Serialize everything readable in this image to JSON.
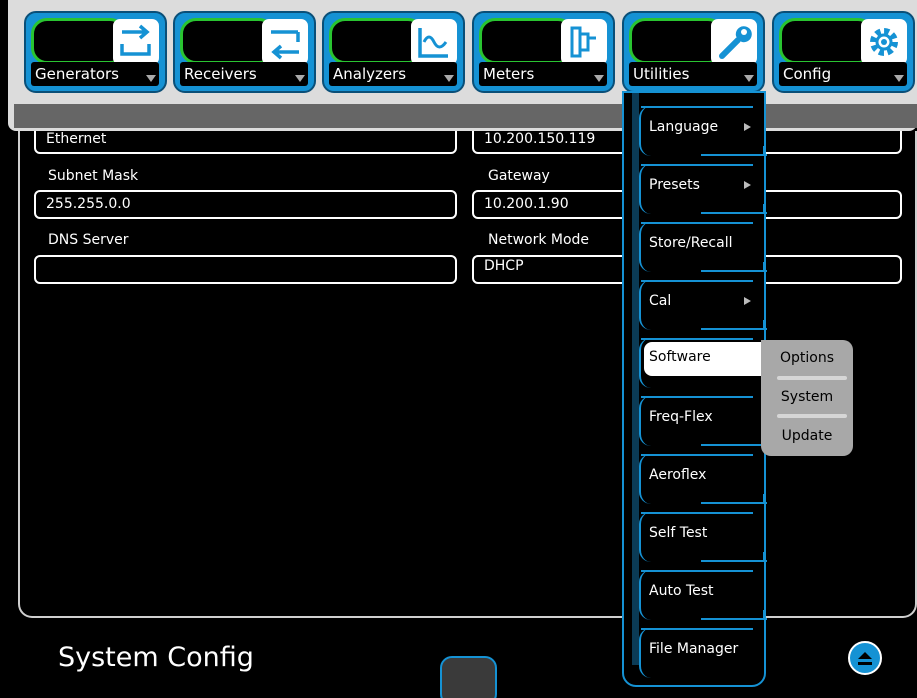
{
  "tabs": [
    {
      "label": "Generators",
      "icon": "generators-arrows-icon"
    },
    {
      "label": "Receivers",
      "icon": "receivers-arrows-icon"
    },
    {
      "label": "Analyzers",
      "icon": "analyzer-wave-icon"
    },
    {
      "label": "Meters",
      "icon": "meter-probe-icon"
    },
    {
      "label": "Utilities",
      "icon": "wrench-icon"
    },
    {
      "label": "Config",
      "icon": "gear-icon"
    }
  ],
  "config": {
    "ethernet_label": "Ethernet",
    "ip_value": "10.200.150.119",
    "subnet_label": "Subnet Mask",
    "subnet_value": "255.255.0.0",
    "gateway_label": "Gateway",
    "gateway_value": "10.200.1.90",
    "dns_label": "DNS Server",
    "dns_value": "",
    "network_mode_label": "Network Mode",
    "network_mode_value": "DHCP"
  },
  "utilities_menu": {
    "items": [
      {
        "label": "Language",
        "has_submenu": true
      },
      {
        "label": "Presets",
        "has_submenu": true
      },
      {
        "label": "Store/Recall",
        "has_submenu": false
      },
      {
        "label": "Cal",
        "has_submenu": true
      },
      {
        "label": "Software",
        "has_submenu": true,
        "selected": true
      },
      {
        "label": "Freq-Flex",
        "has_submenu": false
      },
      {
        "label": "Aeroflex",
        "has_submenu": false
      },
      {
        "label": "Self Test",
        "has_submenu": false
      },
      {
        "label": "Auto Test",
        "has_submenu": false
      },
      {
        "label": "File Manager",
        "has_submenu": false
      }
    ]
  },
  "software_submenu": {
    "items": [
      "Options",
      "System",
      "Update"
    ]
  },
  "footer": {
    "page_title": "System Config",
    "collapse_icon": "collapse-up-icon"
  },
  "colors": {
    "accent": "#1592d4",
    "tab_glow": "#29c431",
    "background": "#000000",
    "submenu": "#a8a8a8"
  }
}
